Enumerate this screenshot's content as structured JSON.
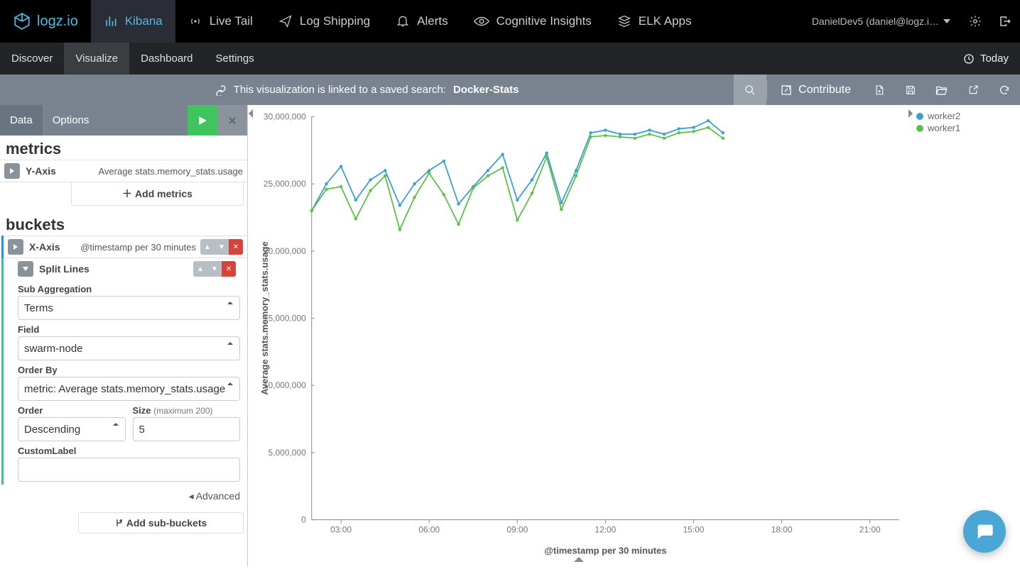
{
  "brand": "logz.io",
  "nav": [
    {
      "label": "Kibana",
      "icon": "bars"
    },
    {
      "label": "Live Tail",
      "icon": "live"
    },
    {
      "label": "Log Shipping",
      "icon": "send"
    },
    {
      "label": "Alerts",
      "icon": "bell"
    },
    {
      "label": "Cognitive Insights",
      "icon": "eye"
    },
    {
      "label": "ELK Apps",
      "icon": "stack"
    }
  ],
  "user": {
    "name": "DanielDev5 (daniel@logz.i…"
  },
  "subnav": {
    "items": [
      "Discover",
      "Visualize",
      "Dashboard",
      "Settings"
    ],
    "active": "Visualize",
    "time": "Today"
  },
  "linkbar": {
    "msg": "This visualization is linked to a saved search:",
    "name": "Docker-Stats",
    "contribute": "Contribute"
  },
  "panel": {
    "tabs": [
      "Data",
      "Options"
    ],
    "metrics_h": "metrics",
    "buckets_h": "buckets",
    "yaxis": {
      "label": "Y-Axis",
      "desc": "Average stats.memory_stats.usage"
    },
    "add_metrics": "Add metrics",
    "xaxis": {
      "label": "X-Axis",
      "desc": "@timestamp per 30 minutes"
    },
    "split": {
      "label": "Split Lines"
    },
    "subagg": {
      "label": "Sub Aggregation",
      "value": "Terms"
    },
    "field": {
      "label": "Field",
      "value": "swarm-node"
    },
    "orderby": {
      "label": "Order By",
      "value": "metric: Average stats.memory_stats.usage"
    },
    "order": {
      "label": "Order",
      "value": "Descending"
    },
    "size": {
      "label": "Size",
      "note": "(maximum 200)",
      "value": "5"
    },
    "custom": {
      "label": "CustomLabel",
      "value": ""
    },
    "adv": "Advanced",
    "add_sub": "Add sub-buckets"
  },
  "chart_data": {
    "type": "line",
    "title": "",
    "xlabel": "@timestamp per 30 minutes",
    "ylabel": "Average stats.memory_stats.usage",
    "ylim": [
      0,
      30000000
    ],
    "yticks": [
      0,
      5000000,
      10000000,
      15000000,
      20000000,
      25000000,
      30000000
    ],
    "ytick_labels": [
      "0",
      "5,000,000",
      "10,000,000",
      "15,000,000",
      "20,000,000",
      "25,000,000",
      "30,000,000"
    ],
    "x": [
      "02:00",
      "02:30",
      "03:00",
      "03:30",
      "04:00",
      "04:30",
      "05:00",
      "05:30",
      "06:00",
      "06:30",
      "07:00",
      "07:30",
      "08:00",
      "08:30",
      "09:00",
      "09:30",
      "10:00",
      "10:30",
      "11:00",
      "11:30",
      "12:00",
      "12:30",
      "13:00",
      "13:30",
      "14:00",
      "14:30",
      "15:00",
      "15:30",
      "16:00"
    ],
    "xtick_labels": [
      "03:00",
      "06:00",
      "09:00",
      "12:00",
      "15:00",
      "18:00",
      "21:00"
    ],
    "xtick_idx": [
      2,
      8,
      14,
      20,
      26,
      32,
      38
    ],
    "series": [
      {
        "name": "worker2",
        "color": "#3a9fd4",
        "values": [
          23000000,
          25000000,
          26300000,
          23800000,
          25300000,
          26000000,
          23400000,
          25000000,
          26000000,
          26700000,
          23500000,
          24800000,
          26000000,
          27200000,
          23800000,
          25300000,
          27300000,
          23600000,
          26000000,
          28800000,
          29000000,
          28700000,
          28700000,
          29000000,
          28700000,
          29100000,
          29200000,
          29700000,
          28800000
        ]
      },
      {
        "name": "worker1",
        "color": "#5cbf4a",
        "values": [
          23000000,
          24600000,
          24800000,
          22400000,
          24500000,
          25600000,
          21600000,
          24000000,
          25800000,
          24200000,
          22000000,
          24700000,
          25600000,
          26200000,
          22300000,
          24300000,
          27000000,
          23100000,
          25600000,
          28500000,
          28600000,
          28500000,
          28400000,
          28700000,
          28400000,
          28800000,
          28900000,
          29200000,
          28400000
        ]
      }
    ],
    "legend": [
      "worker2",
      "worker1"
    ]
  }
}
